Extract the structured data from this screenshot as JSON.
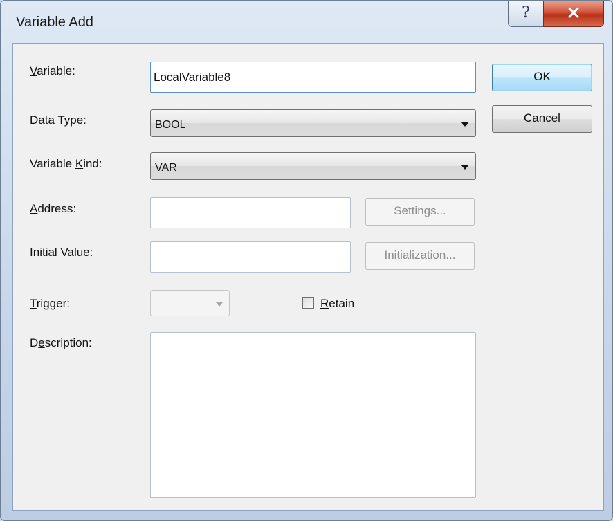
{
  "window": {
    "title": "Variable Add"
  },
  "titlebar": {
    "help_glyph": "?",
    "close_glyph": "✕"
  },
  "form": {
    "variable": {
      "label": "Variable:",
      "value": "LocalVariable8"
    },
    "data_type": {
      "label": "Data Type:",
      "value": "BOOL"
    },
    "variable_kind": {
      "label": "Variable Kind:",
      "value": "VAR"
    },
    "address": {
      "label": "Address:",
      "value": "",
      "button": "Settings..."
    },
    "initial_value": {
      "label": "Initial Value:",
      "value": "",
      "button": "Initialization..."
    },
    "trigger": {
      "label": "Trigger:",
      "value": ""
    },
    "retain": {
      "label": "Retain",
      "checked": false
    },
    "description": {
      "label": "Description:",
      "value": ""
    }
  },
  "buttons": {
    "ok": "OK",
    "cancel": "Cancel"
  }
}
